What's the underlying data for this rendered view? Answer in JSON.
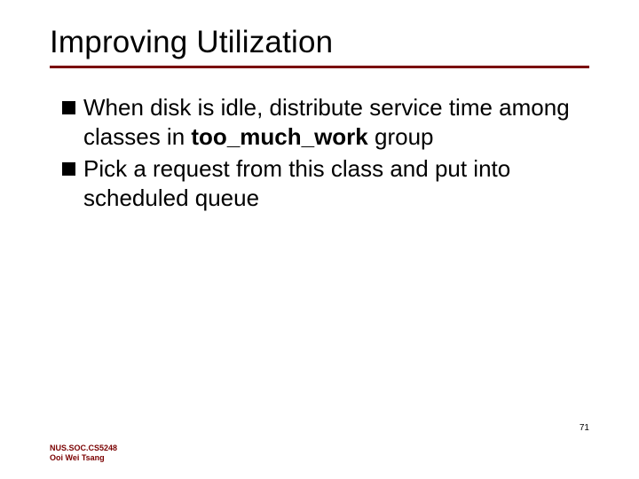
{
  "title": "Improving Utilization",
  "bullets": [
    {
      "pre": "When disk is idle, distribute service time among classes in ",
      "bold": "too_much_work",
      "post": " group"
    },
    {
      "pre": "Pick a request from this class and put into scheduled queue",
      "bold": "",
      "post": ""
    }
  ],
  "page_number": "71",
  "footer_line1": "NUS.SOC.CS5248",
  "footer_line2": "Ooi Wei Tsang"
}
